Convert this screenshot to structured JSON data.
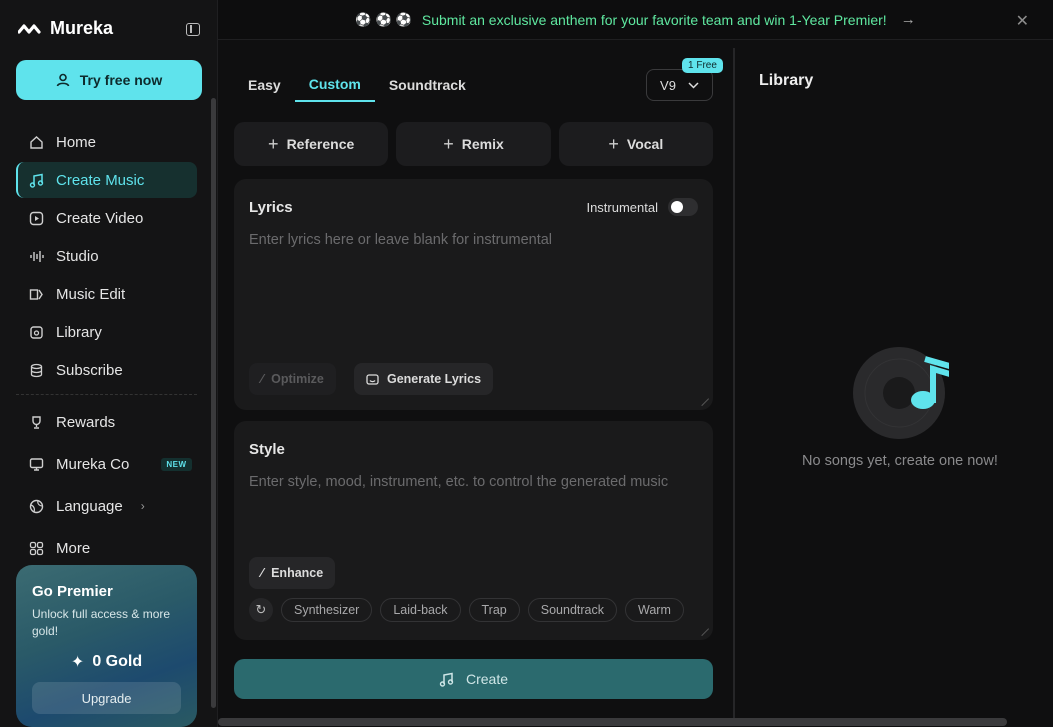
{
  "brand": {
    "name": "Mureka"
  },
  "sidebar": {
    "try_label": "Try free now",
    "items": [
      {
        "label": "Home",
        "icon": "home-icon"
      },
      {
        "label": "Create Music",
        "icon": "music-note-icon"
      },
      {
        "label": "Create Video",
        "icon": "video-icon"
      },
      {
        "label": "Studio",
        "icon": "waveform-icon"
      },
      {
        "label": "Music Edit",
        "icon": "edit-icon"
      },
      {
        "label": "Library",
        "icon": "library-icon"
      },
      {
        "label": "Subscribe",
        "icon": "database-icon"
      }
    ],
    "secondary": [
      {
        "label": "Rewards",
        "icon": "trophy-icon"
      },
      {
        "label": "Mureka Co",
        "icon": "monitor-icon",
        "badge": "NEW"
      },
      {
        "label": "Language",
        "icon": "globe-icon"
      },
      {
        "label": "More",
        "icon": "grid-icon"
      }
    ],
    "premier": {
      "title": "Go Premier",
      "subtitle": "Unlock full access & more gold!",
      "gold": "0 Gold",
      "upgrade_label": "Upgrade"
    }
  },
  "banner": {
    "text": "Submit an exclusive anthem for your favorite team and win 1-Year Premier!"
  },
  "creator": {
    "tabs": [
      "Easy",
      "Custom",
      "Soundtrack"
    ],
    "version": "V9",
    "free_badge": "1 Free",
    "add_buttons": [
      "Reference",
      "Remix",
      "Vocal"
    ],
    "lyrics": {
      "title": "Lyrics",
      "instrumental_label": "Instrumental",
      "placeholder": "Enter lyrics here or leave blank for instrumental",
      "optimize_label": "Optimize",
      "generate_label": "Generate Lyrics"
    },
    "style": {
      "title": "Style",
      "placeholder": "Enter style, mood, instrument, etc. to control the generated music",
      "enhance_label": "Enhance",
      "tags": [
        "Synthesizer",
        "Laid-back",
        "Trap",
        "Soundtrack",
        "Warm"
      ]
    },
    "create_label": "Create"
  },
  "library": {
    "title": "Library",
    "empty_text": "No songs yet, create one now!"
  },
  "colors": {
    "accent": "#5fe3ec",
    "banner_text": "#5fe8a0",
    "background": "#0f0f10"
  }
}
